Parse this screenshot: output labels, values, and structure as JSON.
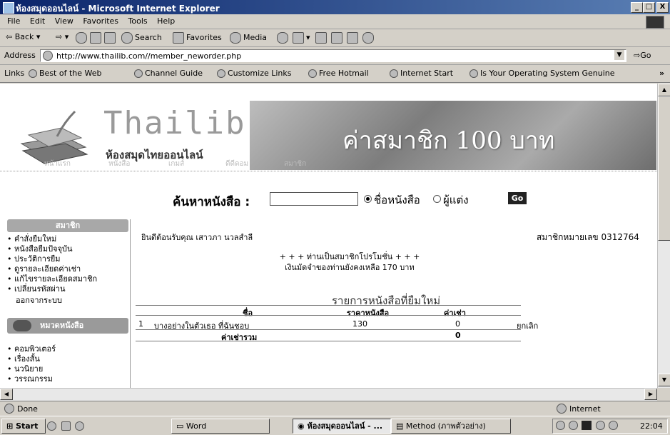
{
  "window": {
    "title": "ห้องสมุดออนไลน์ - Microsoft Internet Explorer",
    "min": "_",
    "max": "□",
    "close": "X"
  },
  "menu": [
    "File",
    "Edit",
    "View",
    "Favorites",
    "Tools",
    "Help"
  ],
  "toolbar": {
    "back": "Back",
    "search": "Search",
    "favorites": "Favorites",
    "media": "Media"
  },
  "address": {
    "label": "Address",
    "url": "http://www.thailib.com//member_neworder.php",
    "go": "Go"
  },
  "links": {
    "label": "Links",
    "items": [
      "Best of the Web",
      "Channel Guide",
      "Customize Links",
      "Free Hotmail",
      "Internet Start",
      "Is Your Operating System Genuine"
    ]
  },
  "site": {
    "logo": "Thailib",
    "logo_sub": "ห้องสมุดไทยออนไลน์",
    "banner": "ค่าสมาชิก 100 บาท",
    "nav": [
      "หน้าแรก",
      "หนังสือ",
      "เกมส์",
      "ดีดีดอม",
      "สมาชิก"
    ]
  },
  "search": {
    "label": "ค้นหาหนังสือ :",
    "opt_title": "ชื่อหนังสือ",
    "opt_author": "ผู้แต่ง",
    "go": "Go"
  },
  "sidebar": {
    "member_header": "สมาชิก",
    "member_items": [
      "คำสั่งยืมใหม่",
      "หนังสือยืมปัจจุบัน",
      "ประวัติการยืม",
      "ดูรายละเอียดค่าเช่า",
      "แก้ไขรายละเอียดสมาชิก",
      "เปลี่ยนรหัสผ่าน"
    ],
    "logout": "ออกจากระบบ",
    "category_header": "หมวดหนังสือ",
    "category_items": [
      "คอมพิวเตอร์",
      "เรื่องสั้น",
      "นวนิยาย",
      "วรรณกรรม"
    ]
  },
  "main": {
    "welcome": "ยินดีต้อนรับคุณ เสาวภา นวลสำลี",
    "member_no": "สมาชิกหมายเลข 0312764",
    "promo1": "+ + + ท่านเป็นสมาชิกโปรโมชั่น + + +",
    "promo2": "เงินมัดจำของท่านยังคงเหลือ 170 บาท",
    "table_title": "รายการหนังสือที่ยืมใหม่",
    "col_name": "ชื่อ",
    "col_price": "ราคาหนังสือ",
    "col_rent": "ค่าเช่า",
    "rows": [
      {
        "no": "1",
        "title": "บางอย่างในตัวเธอ ที่ฉันชอบ",
        "price": "130",
        "rent": "0",
        "action": "ยกเลิก"
      }
    ],
    "total_label": "ค่าเช่ารวม",
    "total_value": "0"
  },
  "status": {
    "text": "Done",
    "zone": "Internet"
  },
  "taskbar": {
    "start": "Start",
    "tasks": [
      "Word",
      "ห้องสมุดออนไลน์ - ...",
      "Method (ภาพตัวอย่าง)"
    ],
    "clock": "22:04"
  }
}
